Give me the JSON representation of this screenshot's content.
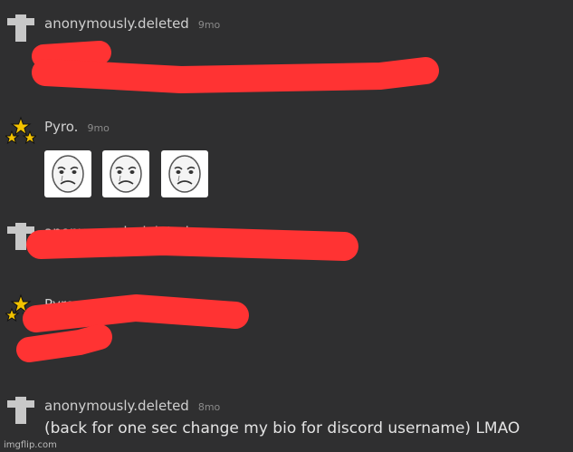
{
  "messages": [
    {
      "user": "anonymously.deleted",
      "time": "9mo",
      "avatar": "deleted-user-icon"
    },
    {
      "user": "Pyro.",
      "time": "9mo",
      "avatar": "stars-avatar-icon",
      "emojis": [
        "crying-face-emoji",
        "crying-face-emoji",
        "crying-face-emoji"
      ]
    },
    {
      "user": "anonymously.deleted",
      "time": "9mo",
      "avatar": "deleted-user-icon"
    },
    {
      "user": "Pyro.",
      "time": "9mo",
      "avatar": "stars-avatar-icon"
    },
    {
      "user": "anonymously.deleted",
      "time": "8mo",
      "avatar": "deleted-user-icon",
      "text": "(back for one sec change my bio for discord username) LMAO"
    }
  ],
  "colors": {
    "redaction": "#ff3333",
    "background": "#2f2f30"
  },
  "watermark": "imgflip.com"
}
